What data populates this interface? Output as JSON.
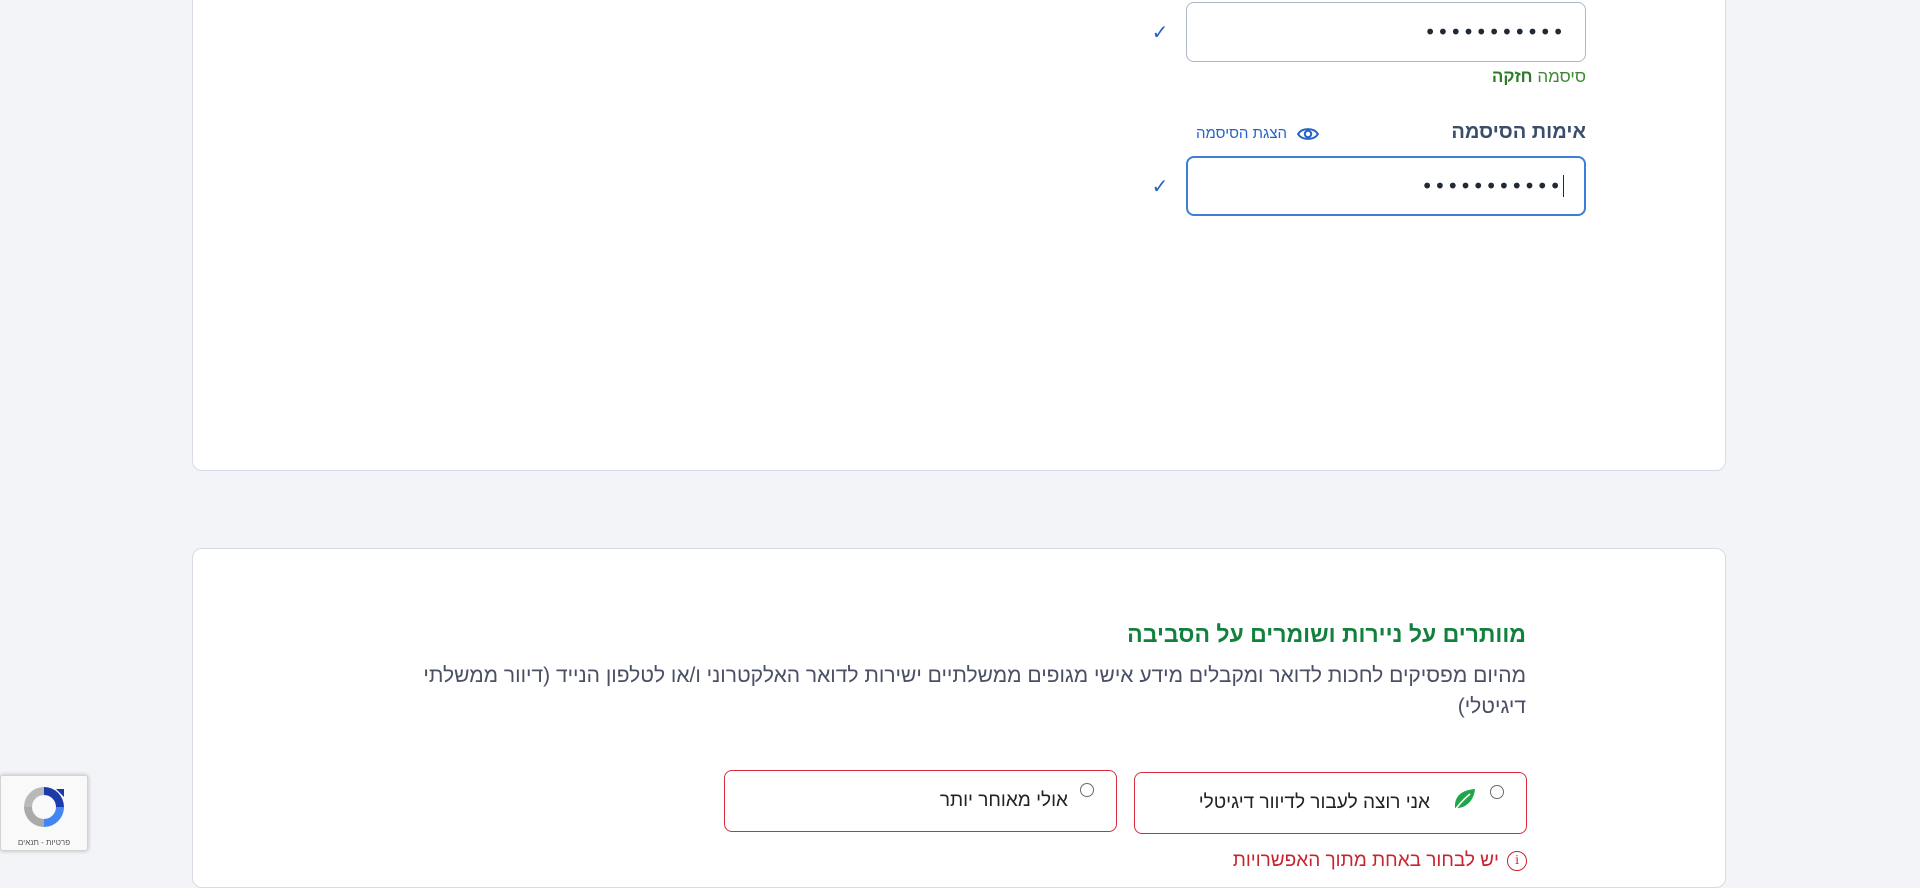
{
  "password_section": {
    "password_value": "•••••••••••",
    "strength_prefix": "סיסמה",
    "strength_value": "חזקה",
    "confirm_label": "אימות הסיסמה",
    "show_password_label": "הצגת הסיסמה",
    "confirm_value": "•••••••••••",
    "check_mark": "✓"
  },
  "digital_mail": {
    "title": "מוותרים על ניירות ושומרים על הסביבה",
    "intro": "מהיום מפסיקים לחכות לדואר ומקבלים מידע אישי מגופים ממשלתיים ישירות לדואר האלקטרוני ו/או לטלפון הנייד (דיוור ממשלתי דיגיטלי)",
    "options": [
      {
        "label": "אני רוצה לעבור לדיוור דיגיטלי",
        "icon": "leaf-icon"
      },
      {
        "label": "אולי מאוחר יותר"
      }
    ],
    "error_text": "יש לבחור באחת מתוך האפשרויות",
    "error_icon": "i"
  },
  "recaptcha": {
    "links": "פרטיות - תנאים"
  },
  "colors": {
    "accent_blue": "#2463c7",
    "success_green": "#12813d",
    "error_red": "#d72d3c",
    "page_bg": "#f2f4f8"
  }
}
